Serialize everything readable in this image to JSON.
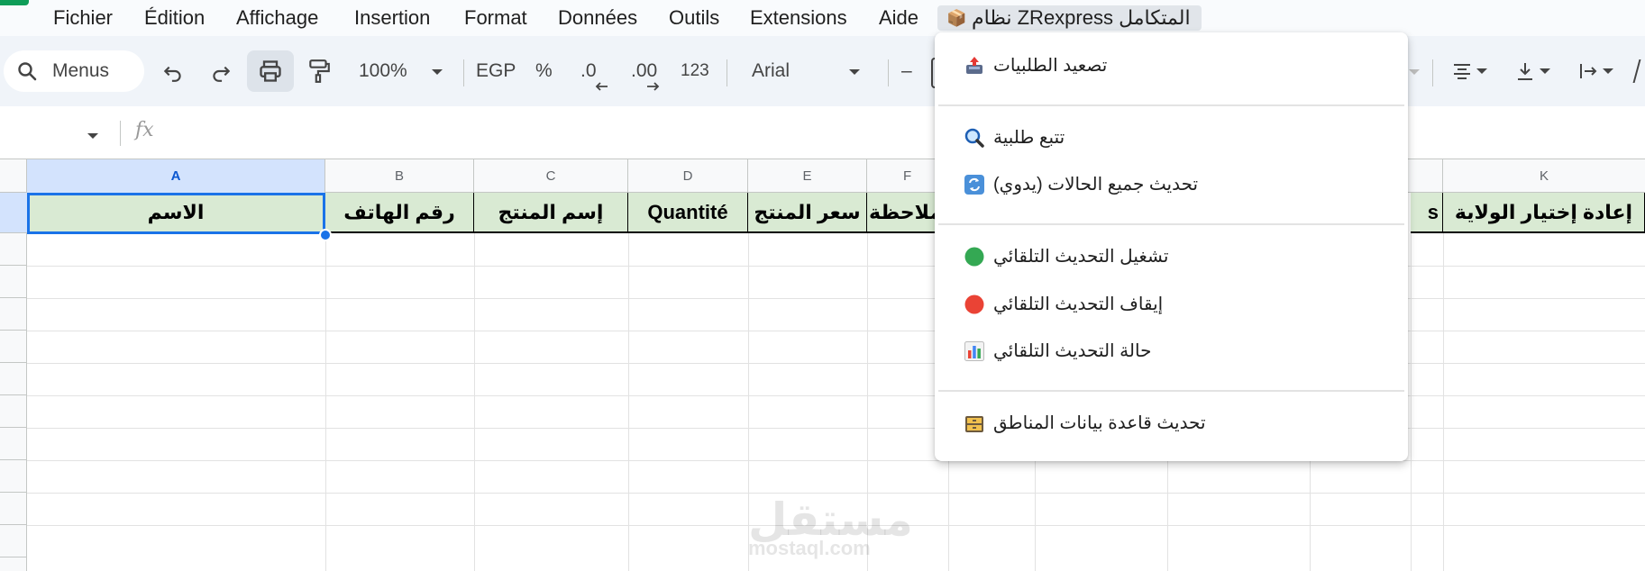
{
  "menubar": {
    "items": [
      "Fichier",
      "Édition",
      "Affichage",
      "Insertion",
      "Format",
      "Données",
      "Outils",
      "Extensions",
      "Aide"
    ],
    "addon_menu": "نظام ZRexpress المتكامل"
  },
  "toolbar": {
    "search_label": "Menus",
    "zoom": "100%",
    "currency": "EGP",
    "percent": "%",
    "decrease_decimal": ".0",
    "increase_decimal": ".00",
    "number_format": "123",
    "font": "Arial",
    "font_size_minus": "–"
  },
  "formula_bar": {
    "fx": "fx"
  },
  "grid": {
    "column_letters": [
      "A",
      "B",
      "C",
      "D",
      "E",
      "F",
      "K"
    ],
    "header_row": [
      "الاسم",
      "رقم الهاتف",
      "إسم المنتج",
      "Quantité",
      "سعر المنتج",
      "ملاحظة",
      "s",
      "إعادة إختيار الولاية"
    ]
  },
  "watermark": {
    "logo": "مستقل",
    "url": "mostaql.com"
  },
  "addon_dropdown": {
    "items": [
      {
        "label": "تصعيد الطلبيات",
        "icon": "outbox-upload-icon"
      },
      {
        "label": "تتبع طلبية",
        "icon": "magnifier-icon"
      },
      {
        "label": "تحديث جميع الحالات (يدوي)",
        "icon": "refresh-arrows-icon"
      },
      {
        "label": "تشغيل التحديث التلقائي",
        "icon": "green-circle-icon"
      },
      {
        "label": "إيقاف التحديث التلقائي",
        "icon": "red-circle-icon"
      },
      {
        "label": "حالة التحديث التلقائي",
        "icon": "bar-chart-icon"
      },
      {
        "label": "تحديث قاعدة بيانات المناطق",
        "icon": "file-cabinet-icon"
      }
    ]
  },
  "colors": {
    "header_fill": "#d9ead3",
    "selection": "#1a73e8",
    "toolbar_bg": "#f0f4f9",
    "status_on": "#34a853",
    "status_off": "#ea4335"
  }
}
